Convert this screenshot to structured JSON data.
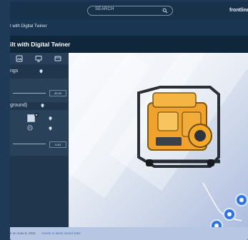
{
  "header": {
    "search_placeholder": "SEARCH",
    "brand": "frontline"
  },
  "breadcrumb": "t with Digital Twiner",
  "page_title": "ilt with Digital Twiner",
  "sidebar": {
    "section_1": "ngs",
    "section_2": "ground)",
    "value_1": "40.00",
    "value_2": "0.43"
  },
  "footer": {
    "saved_text": "e on June 8, 2021",
    "switch_link": "Switch to latest saved state"
  }
}
